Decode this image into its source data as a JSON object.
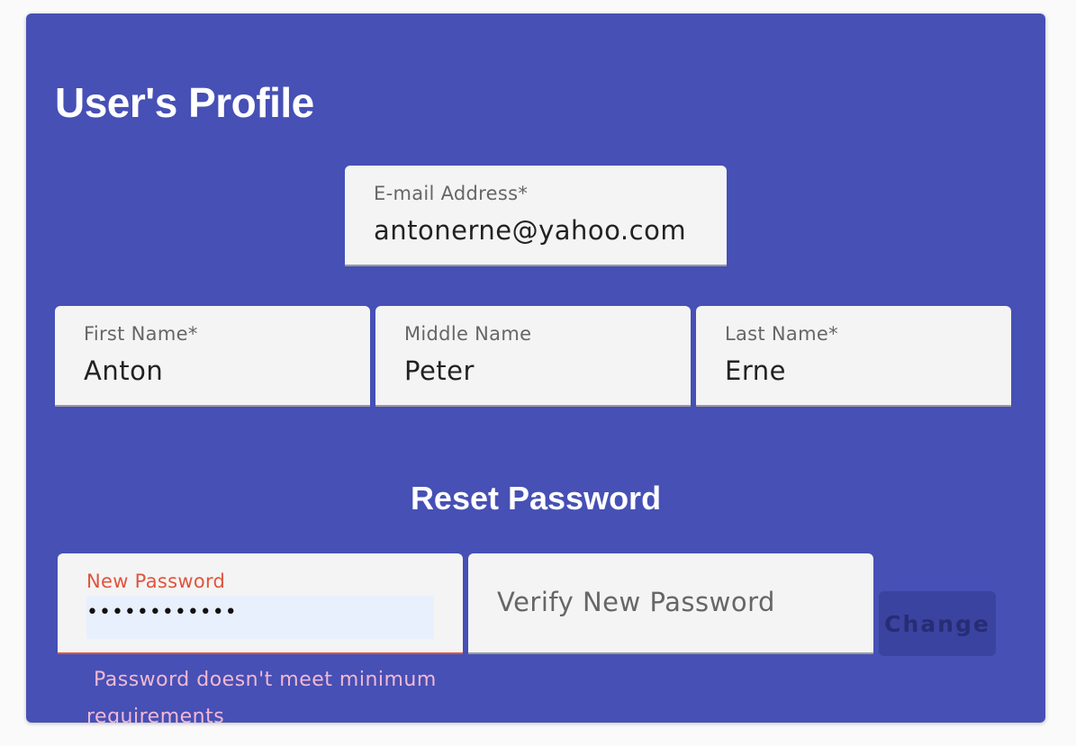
{
  "profile": {
    "title": "User's Profile",
    "email": {
      "label": "E-mail Address*",
      "value": "antonerne@yahoo.com"
    },
    "first_name": {
      "label": "First Name*",
      "value": "Anton"
    },
    "middle_name": {
      "label": "Middle Name",
      "value": "Peter"
    },
    "last_name": {
      "label": "Last Name*",
      "value": "Erne"
    }
  },
  "reset_password": {
    "title": "Reset Password",
    "new_password": {
      "label": "New Password",
      "masked_value": "••••••••••••"
    },
    "verify_password": {
      "placeholder": "Verify New Password"
    },
    "change_label": "Change",
    "error": "Password doesn't meet minimum requirements"
  },
  "colors": {
    "card_background": "#4650b5",
    "field_background": "#f4f4f4",
    "error_label": "#e0543e",
    "error_message": "#f2b8d4",
    "disabled_button": "#3a43a0",
    "autofill_background": "#e8f0fe"
  }
}
